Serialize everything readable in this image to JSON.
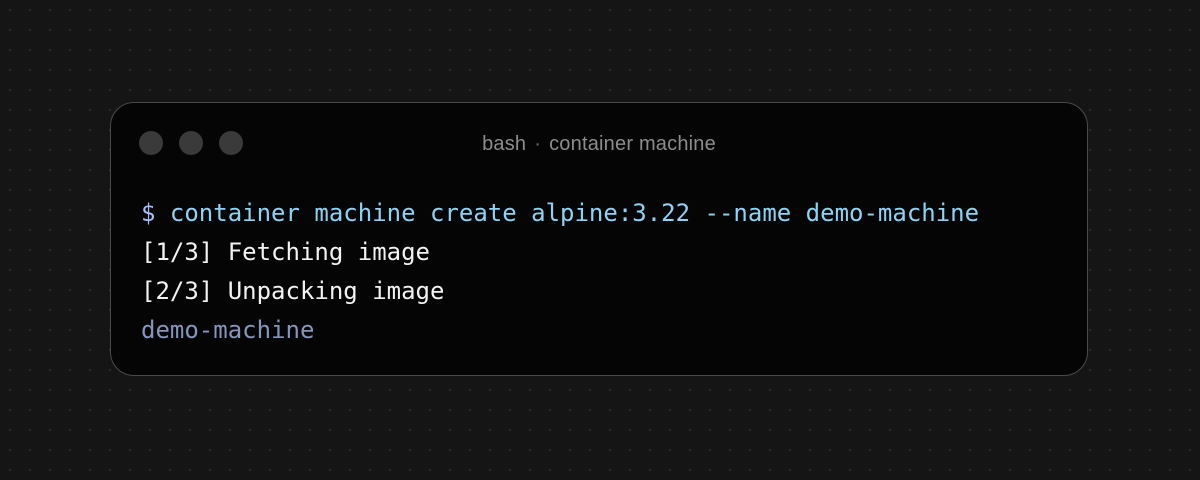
{
  "window": {
    "title_left": "bash",
    "title_separator": "·",
    "title_right": "container machine",
    "controls": [
      "close-dot-icon",
      "minimize-dot-icon",
      "zoom-dot-icon"
    ]
  },
  "terminal": {
    "prompt": "$",
    "command": "container machine create alpine:3.22 --name demo-machine",
    "output": [
      "[1/3] Fetching image",
      "[2/3] Unpacking image"
    ],
    "result": "demo-machine"
  },
  "colors": {
    "background": "#151515",
    "window_background": "#050505",
    "window_border": "#4a4a4a",
    "command": "#8fd3f4",
    "output": "#f2f2f2",
    "result": "#8794bd",
    "title": "#8c8c8c"
  }
}
